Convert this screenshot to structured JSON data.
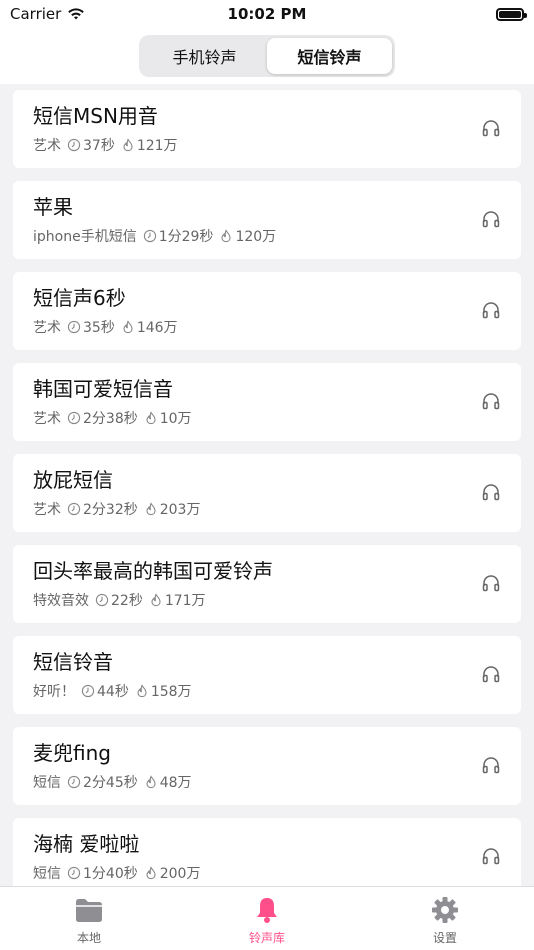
{
  "status_bar": {
    "carrier": "Carrier",
    "time": "10:02 PM"
  },
  "segment": {
    "tabs": [
      "手机铃声",
      "短信铃声"
    ],
    "active_index": 1
  },
  "list": {
    "items": [
      {
        "title": "短信MSN用音",
        "category": "艺术",
        "duration": "37秒",
        "plays": "121万"
      },
      {
        "title": "苹果",
        "category": "iphone手机短信",
        "duration": "1分29秒",
        "plays": "120万"
      },
      {
        "title": "短信声6秒",
        "category": "艺术",
        "duration": "35秒",
        "plays": "146万"
      },
      {
        "title": "韩国可爱短信音",
        "category": "艺术",
        "duration": "2分38秒",
        "plays": "10万"
      },
      {
        "title": "放屁短信",
        "category": "艺术",
        "duration": "2分32秒",
        "plays": "203万"
      },
      {
        "title": "回头率最高的韩国可爱铃声",
        "category": "特效音效",
        "duration": "22秒",
        "plays": "171万"
      },
      {
        "title": "短信铃音",
        "category": "好听！",
        "duration": "44秒",
        "plays": "158万"
      },
      {
        "title": "麦兜fing",
        "category": "短信",
        "duration": "2分45秒",
        "plays": "48万"
      },
      {
        "title": "海楠 爱啦啦",
        "category": "短信",
        "duration": "1分40秒",
        "plays": "200万"
      }
    ]
  },
  "tabbar": {
    "tabs": [
      {
        "label": "本地",
        "icon": "folder-icon"
      },
      {
        "label": "铃声库",
        "icon": "bell-icon"
      },
      {
        "label": "设置",
        "icon": "gear-icon"
      }
    ],
    "active_index": 1,
    "active_color": "#ff4f8b",
    "inactive_color": "#8e8e93"
  }
}
